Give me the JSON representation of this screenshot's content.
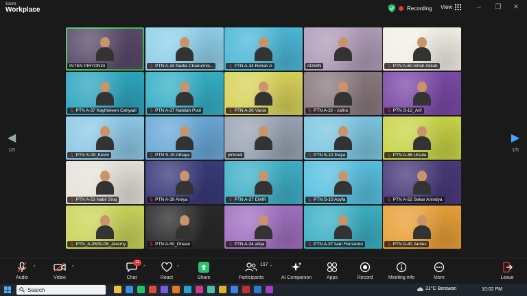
{
  "app": {
    "brand_line1": "zoom",
    "brand_line2": "Workplace",
    "recording_label": "Recording",
    "view_label": "View"
  },
  "gallery": {
    "page_left": "1/5",
    "page_right": "1/5",
    "tiles": [
      {
        "name": "INTEN PIRTONDI",
        "bg": "#5a4a6a",
        "active": true,
        "mic_muted": false
      },
      {
        "name": "PTN A-34 Nadia Chairunnis...",
        "bg": "#8fd0ea",
        "mic_muted": true
      },
      {
        "name": "PTN A-34 Rehan A",
        "bg": "#4cb8d8",
        "mic_muted": true
      },
      {
        "name": "ADMIN",
        "bg": "#b09cb8",
        "mic_muted": false
      },
      {
        "name": "PTN A-60 Alifah Akilah",
        "bg": "#f2efe6",
        "mic_muted": true
      },
      {
        "name": "PTN A-37 Kaytheleen Cahyadi",
        "bg": "#2fa6c0",
        "mic_muted": true
      },
      {
        "name": "PTN A-37 Nabilah Putri",
        "bg": "#36b0c6",
        "mic_muted": true
      },
      {
        "name": "PTN A-36 Vania",
        "bg": "#d8d25a",
        "mic_muted": true
      },
      {
        "name": "PTN A-32 - zafira",
        "bg": "#8a7a80",
        "mic_muted": true
      },
      {
        "name": "PTN S-12_Arif",
        "bg": "#7b4aa8",
        "mic_muted": true
      },
      {
        "name": "PTN S-09_Kevin",
        "bg": "#8ec8e6",
        "mic_muted": true
      },
      {
        "name": "PTN S-10 Athaya",
        "bg": "#6aa8d8",
        "mic_muted": true
      },
      {
        "name": "pirtondi",
        "bg": "#9aa4b4",
        "mic_muted": false
      },
      {
        "name": "PTN S-10 Inaya",
        "bg": "#7cc6e0",
        "mic_muted": true
      },
      {
        "name": "PTN A-36 Ursula",
        "bg": "#c8d448",
        "mic_muted": true
      },
      {
        "name": "PTN A-53 Nabil Siraj",
        "bg": "#e6e2da",
        "mic_muted": true
      },
      {
        "name": "PTN A-39 Ainiya",
        "bg": "#3a3a7a",
        "mic_muted": true
      },
      {
        "name": "PTN A-37 EMIR",
        "bg": "#40b0c8",
        "mic_muted": true
      },
      {
        "name": "PTN S-10 Asyfa",
        "bg": "#58c0e0",
        "mic_muted": true
      },
      {
        "name": "PTN A-52 Sekar Anindya",
        "bg": "#4a3a7a",
        "mic_muted": true
      },
      {
        "name": "PTN_A-36/SI-06_Jeremy",
        "bg": "#cad45a",
        "mic_muted": true
      },
      {
        "name": "PTN A-50_Dhean",
        "bg": "#2a2a2a",
        "mic_muted": true
      },
      {
        "name": "PTN A-34 aliqa",
        "bg": "#a070c0",
        "mic_muted": true
      },
      {
        "name": "PTN A-37 Ivan Fernando",
        "bg": "#3cb0c4",
        "mic_muted": true
      },
      {
        "name": "PTN A-40 James",
        "bg": "#e8a038",
        "mic_muted": true
      }
    ]
  },
  "toolbar": {
    "audio_label": "Audio",
    "video_label": "Video",
    "chat_label": "Chat",
    "chat_badge": "11",
    "react_label": "React",
    "share_label": "Share",
    "participants_label": "Participants",
    "participants_count": "197",
    "ai_label": "AI Companion",
    "apps_label": "Apps",
    "record_label": "Record",
    "meeting_info_label": "Meeting info",
    "more_label": "More",
    "leave_label": "Leave"
  },
  "taskbar": {
    "search_label": "Search",
    "weather": "31°C  Berawan",
    "time": "10:02 PM"
  },
  "colors": {
    "accent_green": "#45c254",
    "record_red": "#e53935",
    "nav_blue": "#4aa3ff",
    "share_green": "#27c26c"
  }
}
